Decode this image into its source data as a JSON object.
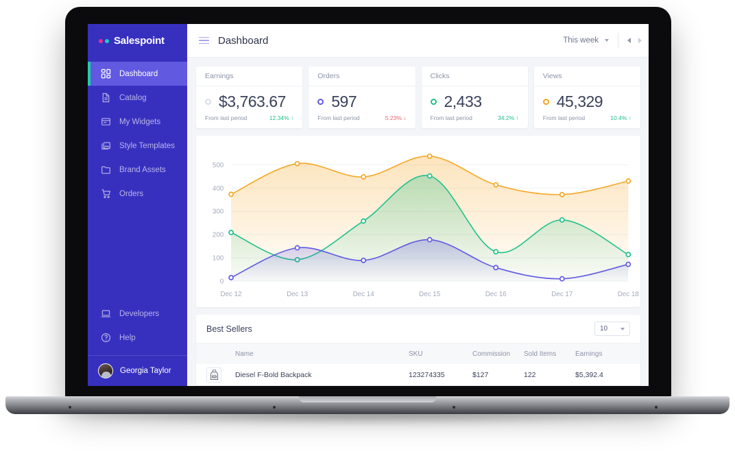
{
  "sidebar": {
    "brand": "Salespoint",
    "items": [
      {
        "label": "Dashboard",
        "icon": "grid-icon",
        "active": true
      },
      {
        "label": "Catalog",
        "icon": "document-icon",
        "active": false
      },
      {
        "label": "My Widgets",
        "icon": "widget-icon",
        "active": false
      },
      {
        "label": "Style Templates",
        "icon": "images-icon",
        "active": false
      },
      {
        "label": "Brand Assets",
        "icon": "folder-icon",
        "active": false
      },
      {
        "label": "Orders",
        "icon": "cart-icon",
        "active": false
      }
    ],
    "bottom_items": [
      {
        "label": "Developers",
        "icon": "laptop-icon"
      },
      {
        "label": "Help",
        "icon": "question-circle-icon"
      }
    ],
    "user": {
      "name": "Georgia Taylor"
    },
    "accent_active": "#6159e0",
    "accent_bar": "#1fcfa8",
    "background": "#3730bf"
  },
  "topbar": {
    "menu_icon": "hamburger-icon",
    "title": "Dashboard",
    "period": "This week",
    "prev_label": "◀",
    "next_label": "▶"
  },
  "stats": [
    {
      "title": "Earnings",
      "value": "$3,763.67",
      "sub": "From last period",
      "delta": "12.34% ↑",
      "dir": "up",
      "marker": "none"
    },
    {
      "title": "Orders",
      "value": "597",
      "sub": "From last period",
      "delta": "5.23% ↓",
      "dir": "down",
      "marker": "purple"
    },
    {
      "title": "Clicks",
      "value": "2,433",
      "sub": "From last period",
      "delta": "34.2% ↑",
      "dir": "up",
      "marker": "green"
    },
    {
      "title": "Views",
      "value": "45,329",
      "sub": "From last period",
      "delta": "10.4% ↑",
      "dir": "up",
      "marker": "orange"
    }
  ],
  "chart_data": {
    "type": "area",
    "title": "",
    "xlabel": "",
    "ylabel": "",
    "grid": true,
    "legend": "none",
    "x": [
      "Dec 12",
      "Dec 13",
      "Dec 14",
      "Dec 15",
      "Dec 16",
      "Dec 17",
      "Dec 18"
    ],
    "yticks": [
      0,
      100,
      200,
      300,
      400,
      500
    ],
    "ylim": [
      0,
      560
    ],
    "series": [
      {
        "name": "Views",
        "color": "#f5a623",
        "values": [
          373,
          505,
          448,
          537,
          414,
          372,
          430
        ]
      },
      {
        "name": "Clicks",
        "color": "#1fc08a",
        "values": [
          209,
          92,
          258,
          452,
          126,
          263,
          114
        ]
      },
      {
        "name": "Orders",
        "color": "#6159e0",
        "values": [
          15,
          143,
          89,
          178,
          58,
          10,
          72
        ]
      }
    ]
  },
  "best_sellers": {
    "title": "Best Sellers",
    "page_size": "10",
    "columns": [
      "",
      "Name",
      "SKU",
      "Commission",
      "Sold Items",
      "Earnings"
    ],
    "rows": [
      {
        "thumb": "backpack-thumbnail",
        "name": "Diesel F-Bold Backpack",
        "sku": "123274335",
        "commission": "$127",
        "sold": "122",
        "earnings": "$5,392.4"
      }
    ]
  }
}
